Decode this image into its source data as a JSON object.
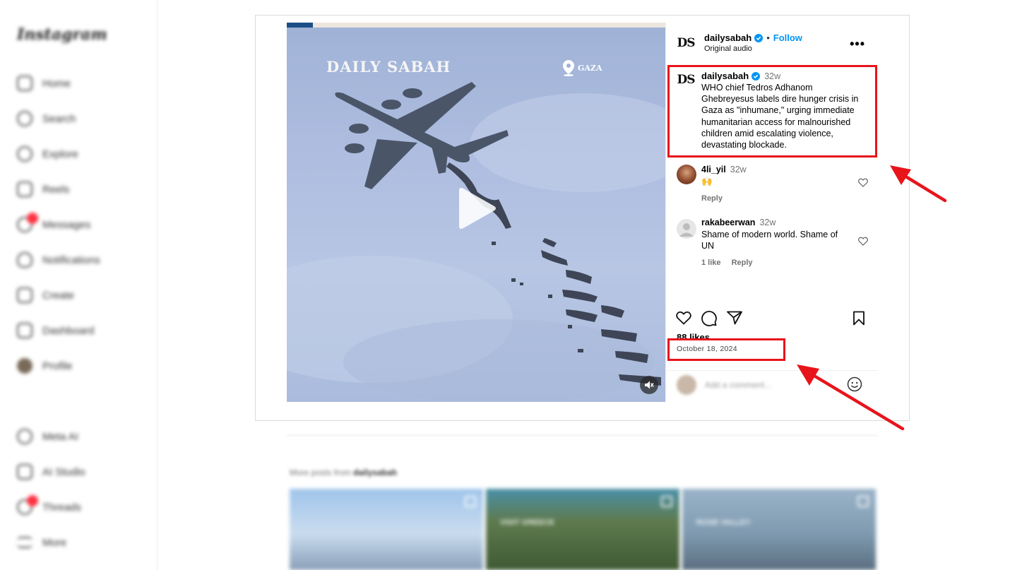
{
  "sidebar": {
    "logo": "Instagram",
    "items": [
      {
        "label": "Home",
        "icon": "home-icon"
      },
      {
        "label": "Search",
        "icon": "search-icon"
      },
      {
        "label": "Explore",
        "icon": "explore-icon"
      },
      {
        "label": "Reels",
        "icon": "reels-icon"
      },
      {
        "label": "Messages",
        "icon": "messages-icon"
      },
      {
        "label": "Notifications",
        "icon": "heart-icon"
      },
      {
        "label": "Create",
        "icon": "plus-icon"
      },
      {
        "label": "Dashboard",
        "icon": "dashboard-icon"
      },
      {
        "label": "Profile",
        "icon": "avatar-icon"
      },
      {
        "label": "Meta AI",
        "icon": "meta-ai-icon"
      },
      {
        "label": "AI Studio",
        "icon": "ai-studio-icon"
      },
      {
        "label": "Threads",
        "icon": "threads-icon"
      },
      {
        "label": "More",
        "icon": "menu-icon"
      }
    ]
  },
  "media": {
    "brand": "DAILY SABAH",
    "location": "GAZA"
  },
  "post": {
    "username": "dailysabah",
    "follow_label": "Follow",
    "audio": "Original audio",
    "more_label": "•••",
    "caption_time": "32w",
    "caption": "WHO chief Tedros Adhanom Ghebreyesus labels dire hunger crisis in Gaza as \"inhumane,\" urging immediate humanitarian access for malnourished children amid escalating violence, devastating blockade.",
    "likes": "88 likes",
    "date": "October 18, 2024",
    "add_comment_placeholder": "Add a comment..."
  },
  "comments": [
    {
      "user": "4li_yil",
      "time": "32w",
      "text": "🙌",
      "reply": "Reply"
    },
    {
      "user": "rakabeerwan",
      "time": "32w",
      "text": "Shame of modern world. Shame of UN",
      "likes": "1 like",
      "reply": "Reply"
    }
  ],
  "more_posts": {
    "prefix": "More posts from",
    "user": "dailysabah",
    "thumb_labels": [
      "",
      "VISIT GREECE",
      "ROSE VALLEY"
    ]
  },
  "colors": {
    "annotation_red": "#e8141b",
    "link_blue": "#0095f6",
    "verified_blue": "#0095f6"
  }
}
